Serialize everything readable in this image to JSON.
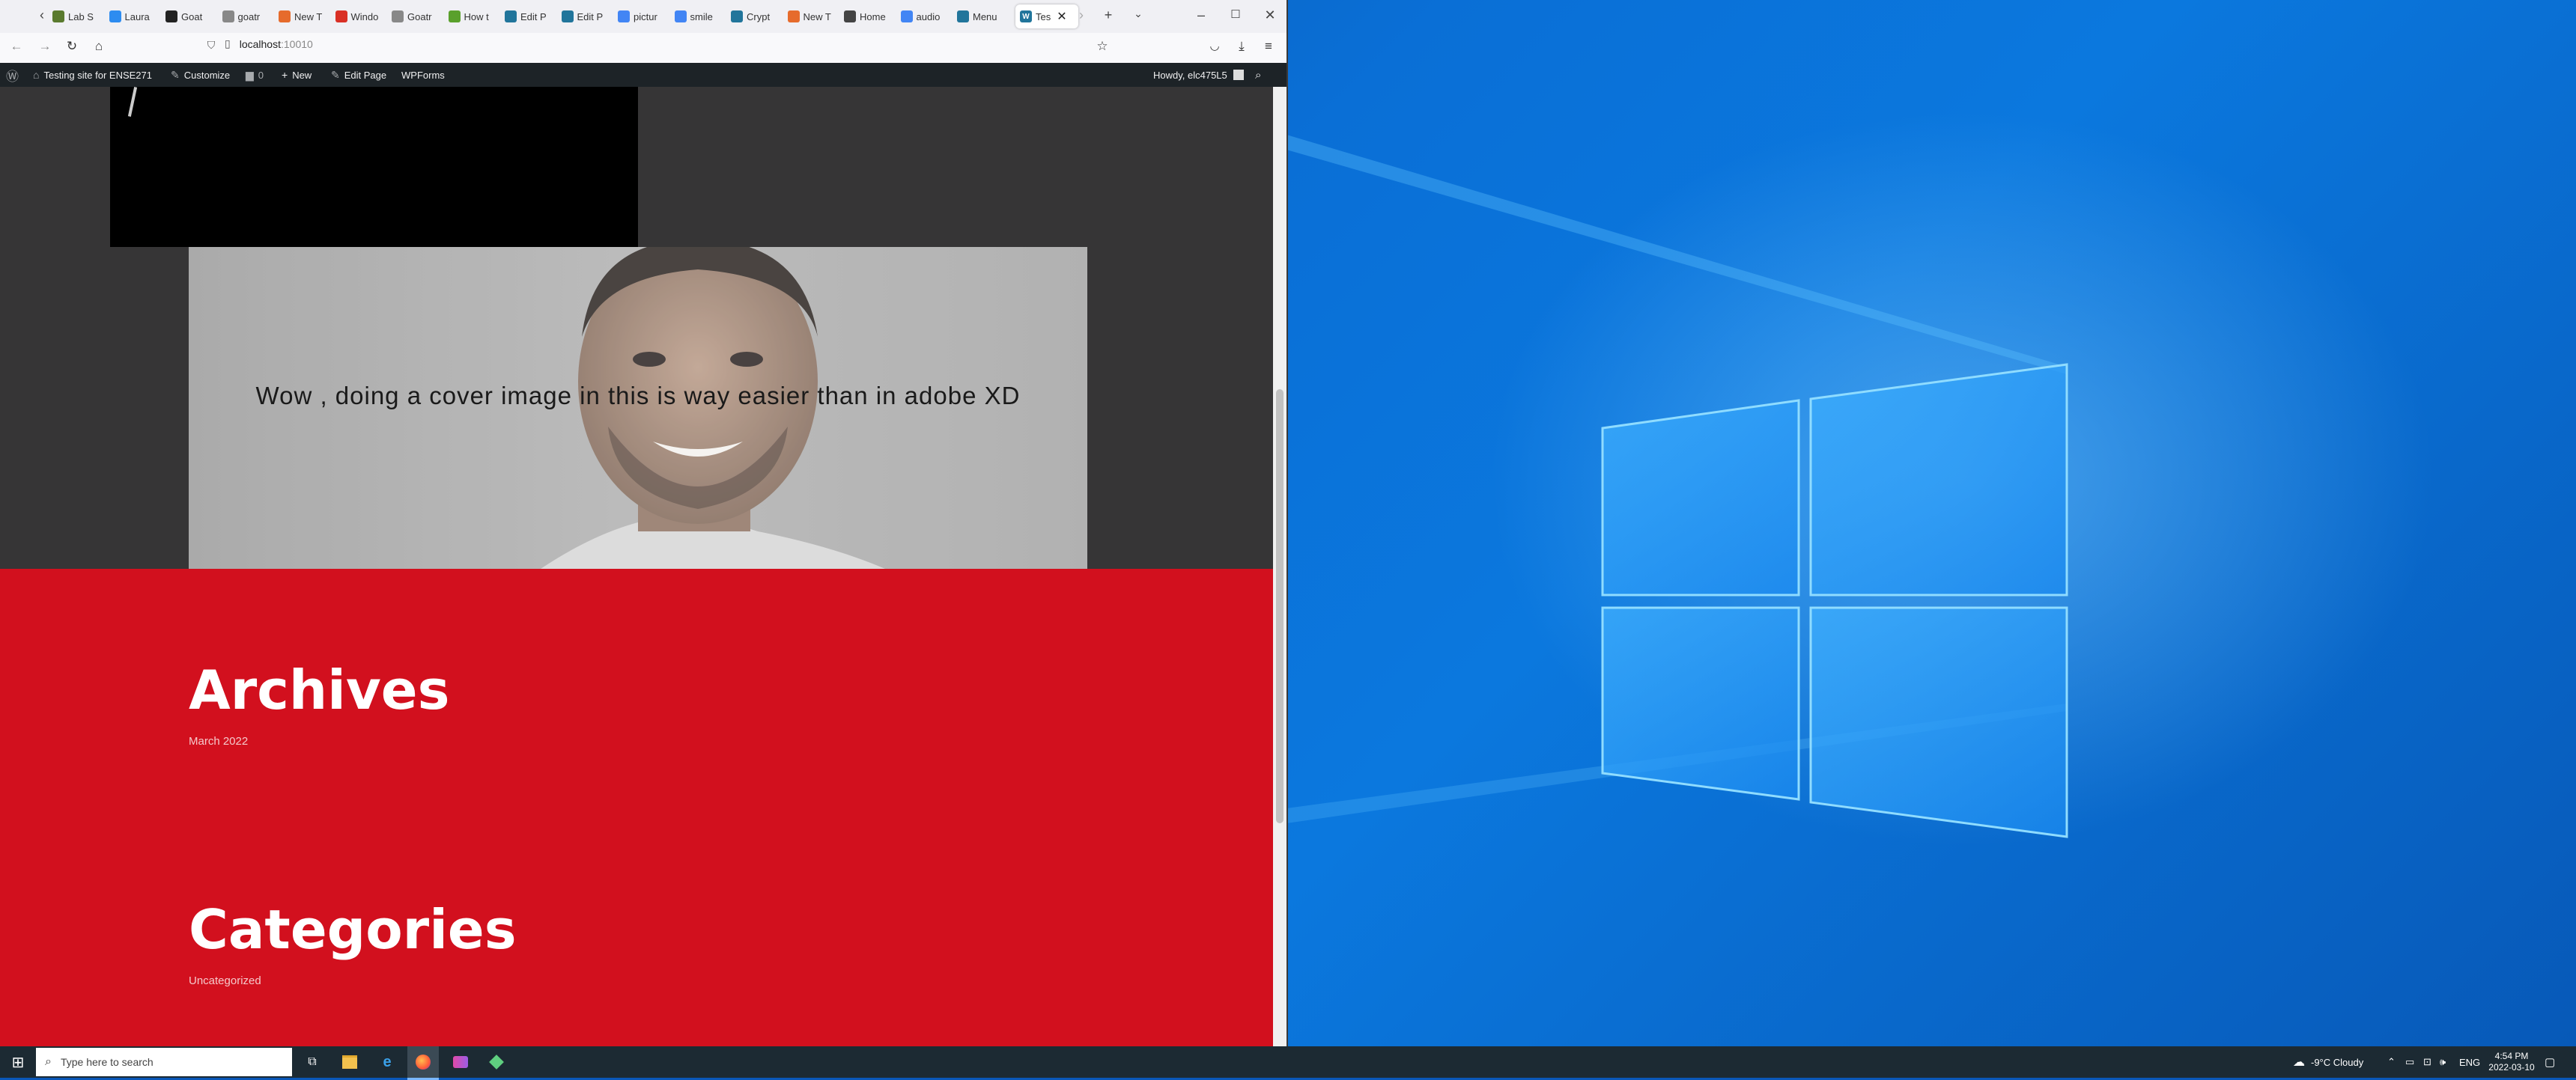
{
  "browser": {
    "tabs": [
      {
        "label": "Lab S",
        "fav": "#5a7a2e"
      },
      {
        "label": "Laura",
        "fav": "#2d8cf0"
      },
      {
        "label": "Goat",
        "fav": "#222"
      },
      {
        "label": "goatr",
        "fav": "#888"
      },
      {
        "label": "New T",
        "fav": "#e66b2c"
      },
      {
        "label": "Windo",
        "fav": "#d93025"
      },
      {
        "label": "Goatr",
        "fav": "#888"
      },
      {
        "label": "How t",
        "fav": "#5aa02c"
      },
      {
        "label": "Edit P",
        "fav": "#21759b"
      },
      {
        "label": "Edit P",
        "fav": "#21759b"
      },
      {
        "label": "pictur",
        "fav": "#4285f4"
      },
      {
        "label": "smile",
        "fav": "#4285f4"
      },
      {
        "label": "Crypt",
        "fav": "#21759b"
      },
      {
        "label": "New T",
        "fav": "#e66b2c"
      },
      {
        "label": "Home",
        "fav": "#444"
      },
      {
        "label": "audio",
        "fav": "#4285f4"
      },
      {
        "label": "Menu",
        "fav": "#21759b"
      }
    ],
    "active_tab": {
      "label": "Tes",
      "fav": "#21759b"
    },
    "url_host": "localhost",
    "url_port": ":10010"
  },
  "adminbar": {
    "site_name": "Testing site for ENSE271",
    "customize": "Customize",
    "comments_count": "0",
    "new": "New",
    "edit_page": "Edit Page",
    "wpforms": "WPForms",
    "howdy": "Howdy, elc475L5"
  },
  "page": {
    "cover_text": "Wow , doing a cover image in this is way easier than in adobe XD",
    "archives_title": "Archives",
    "archives_link": "March 2022",
    "categories_title": "Categories",
    "categories_link": "Uncategorized"
  },
  "taskbar": {
    "search_placeholder": "Type here to search",
    "weather": "-9°C  Cloudy",
    "language": "ENG",
    "time": "4:54 PM",
    "date": "2022-03-10"
  }
}
